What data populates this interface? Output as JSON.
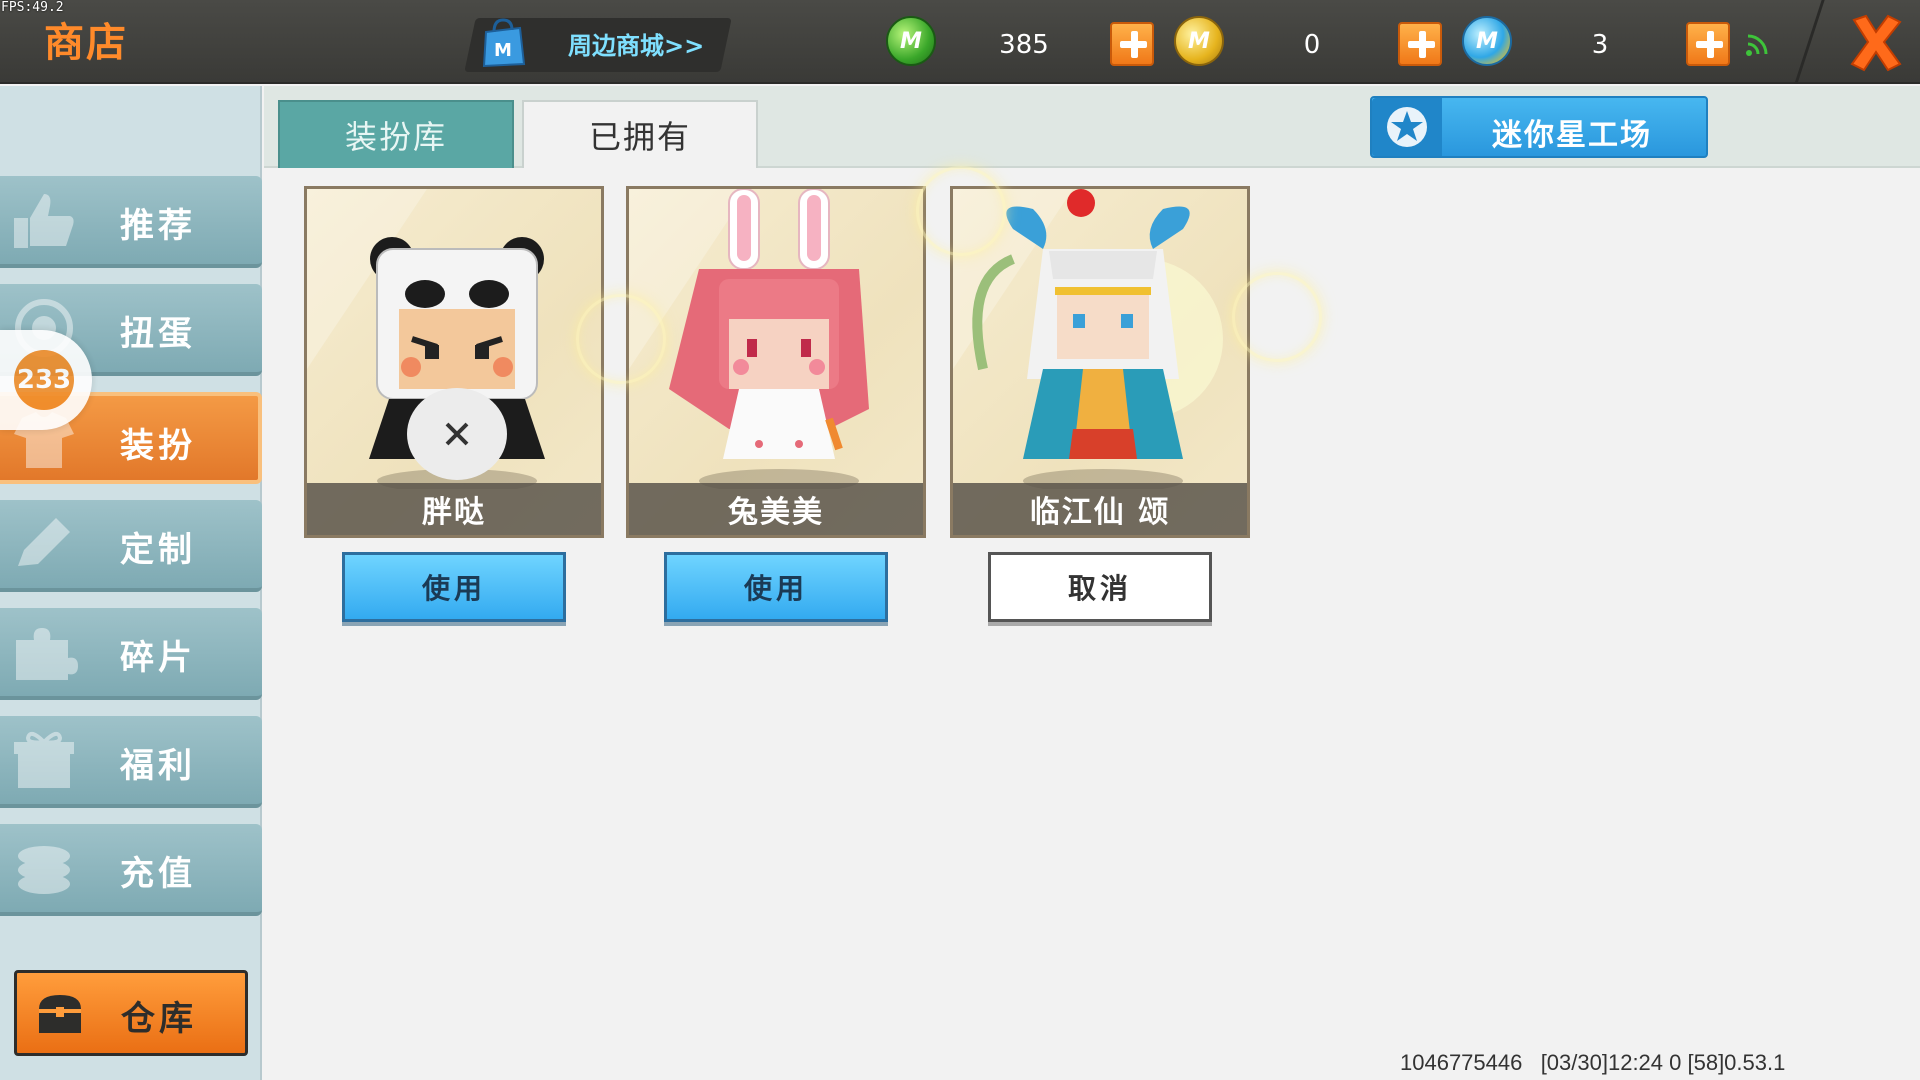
{
  "fps": "FPS:49.2",
  "topbar": {
    "title": "商店",
    "mall_link": "周边商城>>",
    "currencies": [
      {
        "name": "green-mini-bean",
        "value": "385",
        "color": "#3aa72a"
      },
      {
        "name": "gold-mini-coin",
        "value": "0",
        "color": "#e6b41e"
      },
      {
        "name": "blue-mini-point",
        "value": "3",
        "color": "#2fa7e6"
      }
    ]
  },
  "sidebar": {
    "items": [
      {
        "label": "推荐",
        "icon": "thumbs-up-icon"
      },
      {
        "label": "扭蛋",
        "icon": "capsule-icon"
      },
      {
        "label": "装扮",
        "icon": "costume-icon",
        "active": true
      },
      {
        "label": "定制",
        "icon": "pencil-icon"
      },
      {
        "label": "碎片",
        "icon": "puzzle-icon"
      },
      {
        "label": "福利",
        "icon": "gift-icon"
      },
      {
        "label": "充值",
        "icon": "coins-icon"
      }
    ],
    "badge": "233",
    "warehouse": "仓库"
  },
  "tabs": {
    "library": "装扮库",
    "owned": "已拥有"
  },
  "workshop_button": "迷你星工场",
  "cards": [
    {
      "name": "胖哒",
      "action": "使用"
    },
    {
      "name": "兔美美",
      "action": "使用"
    },
    {
      "name": "临江仙 颂",
      "action": "取消"
    }
  ],
  "footer": "1046775446   [03/30]12:24 0 [58]0.53.1",
  "colors": {
    "accent_orange": "#f08d2a",
    "teal_tab": "#5aa7a4",
    "blue_button": "#33aaf0"
  }
}
